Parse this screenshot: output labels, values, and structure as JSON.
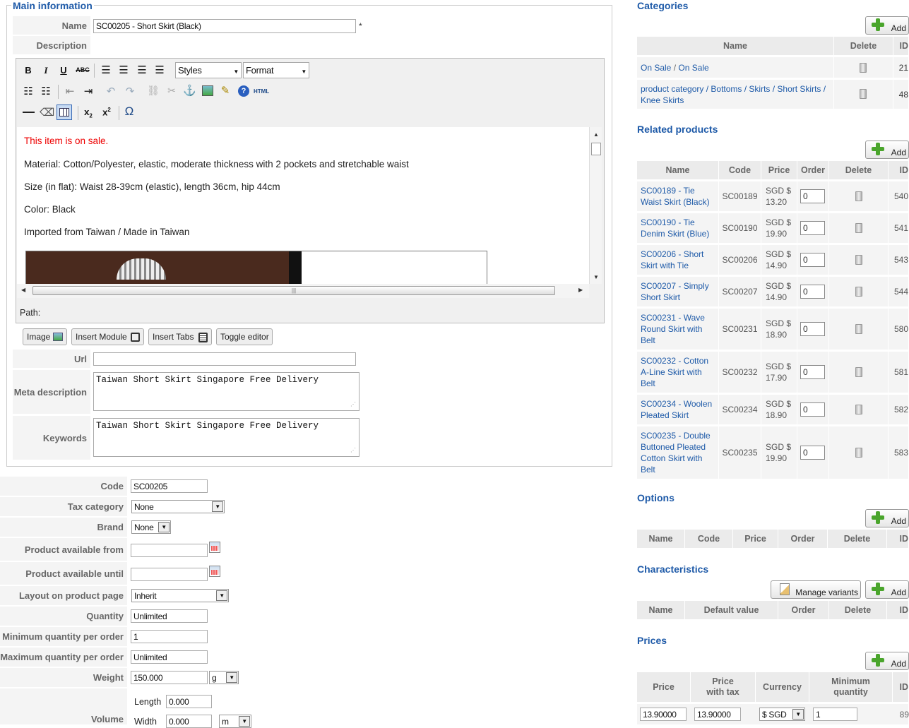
{
  "main_info": {
    "legend": "Main information",
    "name_label": "Name",
    "name_value": "SC00205 - Short Skirt (Black)",
    "required_mark": "*",
    "description_label": "Description",
    "editor": {
      "styles": "Styles",
      "format": "Format",
      "html_label": "HTML",
      "path_label": "Path:",
      "content": {
        "sale": "This item is on sale.",
        "material": "Material: Cotton/Polyester, elastic, moderate thickness with 2 pockets and stretchable waist",
        "size": "Size (in flat): Waist 28-39cm (elastic), length 36cm, hip 44cm",
        "color": "Color: Black",
        "imported": "Imported from Taiwan / Made in Taiwan"
      },
      "buttons": {
        "image": "Image",
        "insert_module": "Insert Module",
        "insert_tabs": "Insert Tabs",
        "toggle_editor": "Toggle editor"
      }
    },
    "url_label": "Url",
    "url_value": "",
    "meta_label": "Meta description",
    "meta_value": "Taiwan Short Skirt Singapore Free Delivery",
    "keywords_label": "Keywords",
    "keywords_value": "Taiwan Short Skirt Singapore Free Delivery"
  },
  "details": {
    "code_label": "Code",
    "code_value": "SC00205",
    "tax_label": "Tax category",
    "tax_value": "None",
    "brand_label": "Brand",
    "brand_value": "None",
    "avail_from_label": "Product available from",
    "avail_until_label": "Product available until",
    "layout_label": "Layout on product page",
    "layout_value": "Inherit",
    "quantity_label": "Quantity",
    "quantity_value": "Unlimited",
    "min_label": "Minimum quantity per order",
    "min_value": "1",
    "max_label": "Maximum quantity per order",
    "max_value": "Unlimited",
    "weight_label": "Weight",
    "weight_value": "150.000",
    "weight_unit": "g",
    "volume_label": "Volume",
    "length_label": "Length",
    "length_value": "0.000",
    "width_label": "Width",
    "width_value": "0.000",
    "dim_unit": "m"
  },
  "add_label": "Add",
  "categories": {
    "legend": "Categories",
    "headers": {
      "name": "Name",
      "delete": "Delete",
      "id": "ID"
    },
    "rows": [
      {
        "parts": [
          "On Sale",
          "On Sale"
        ],
        "id": "21"
      },
      {
        "line1": "product category / Bottoms / Skirts / Short Skirts /",
        "line2": "Knee Skirts",
        "id": "48"
      }
    ]
  },
  "related": {
    "legend": "Related products",
    "headers": {
      "name": "Name",
      "code": "Code",
      "price": "Price",
      "order": "Order",
      "delete": "Delete",
      "id": "ID"
    },
    "rows": [
      {
        "name": [
          "SC00189 - Tie",
          "Waist Skirt (Black)"
        ],
        "code": "SC00189",
        "price": [
          "SGD $",
          "13.20"
        ],
        "order": "0",
        "id": "540"
      },
      {
        "name": [
          "SC00190 - Tie",
          "Denim Skirt (Blue)"
        ],
        "code": "SC00190",
        "price": [
          "SGD $",
          "19.90"
        ],
        "order": "0",
        "id": "541"
      },
      {
        "name": [
          "SC00206 - Short",
          "Skirt with Tie"
        ],
        "code": "SC00206",
        "price": [
          "SGD $",
          "14.90"
        ],
        "order": "0",
        "id": "543"
      },
      {
        "name": [
          "SC00207 - Simply",
          "Short Skirt"
        ],
        "code": "SC00207",
        "price": [
          "SGD $",
          "14.90"
        ],
        "order": "0",
        "id": "544"
      },
      {
        "name": [
          "SC00231 - Wave",
          "Round Skirt with",
          "Belt"
        ],
        "code": "SC00231",
        "price": [
          "SGD $",
          "18.90"
        ],
        "order": "0",
        "id": "580"
      },
      {
        "name": [
          "SC00232 - Cotton",
          "A-Line Skirt with",
          "Belt"
        ],
        "code": "SC00232",
        "price": [
          "SGD $",
          "17.90"
        ],
        "order": "0",
        "id": "581"
      },
      {
        "name": [
          "SC00234 - Woolen",
          "Pleated Skirt"
        ],
        "code": "SC00234",
        "price": [
          "SGD $",
          "18.90"
        ],
        "order": "0",
        "id": "582"
      },
      {
        "name": [
          "SC00235 - Double",
          "Buttoned Pleated",
          "Cotton Skirt with",
          "Belt"
        ],
        "code": "SC00235",
        "price": [
          "SGD $",
          "19.90"
        ],
        "order": "0",
        "id": "583"
      }
    ]
  },
  "options": {
    "legend": "Options",
    "headers": {
      "name": "Name",
      "code": "Code",
      "price": "Price",
      "order": "Order",
      "delete": "Delete",
      "id": "ID"
    }
  },
  "characteristics": {
    "legend": "Characteristics",
    "manage_variants": "Manage variants",
    "headers": {
      "name": "Name",
      "default_value": "Default value",
      "order": "Order",
      "delete": "Delete",
      "id": "ID"
    }
  },
  "prices": {
    "legend": "Prices",
    "headers": {
      "price": "Price",
      "price_tax": "Price with tax",
      "currency": "Currency",
      "min_qty": "Minimum quantity",
      "id": "ID"
    },
    "row": {
      "price": "13.90000",
      "price_tax": "13.90000",
      "currency": "$ SGD",
      "min_qty": "1",
      "id": "89"
    }
  }
}
